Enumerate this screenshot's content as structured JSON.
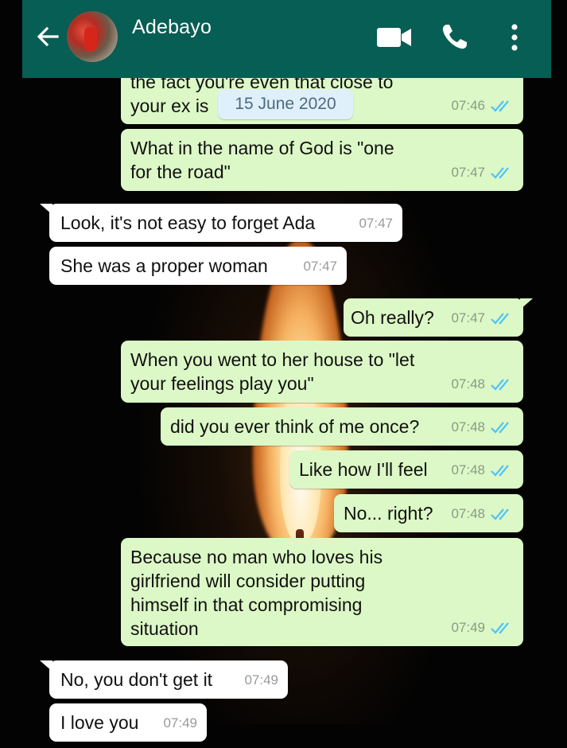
{
  "header": {
    "back_icon": "arrow-left-icon",
    "contact_name": "Adebayo",
    "video_icon": "video-camera-icon",
    "call_icon": "phone-icon",
    "menu_icon": "more-vertical-icon",
    "color": "#075e54"
  },
  "date_chip": "15 June 2020",
  "messages": [
    {
      "dir": "out",
      "lines": [
        "the fact you're even that close to",
        "your ex is"
      ],
      "time": "07:46",
      "ticks": "read"
    },
    {
      "dir": "out",
      "lines": [
        "What in the name of God is \"one",
        "for the road\""
      ],
      "time": "07:47",
      "ticks": "read"
    },
    {
      "dir": "in",
      "lines": [
        "Look, it's not easy to forget Ada"
      ],
      "time": "07:47"
    },
    {
      "dir": "in",
      "lines": [
        "She was a proper woman"
      ],
      "time": "07:47"
    },
    {
      "dir": "out",
      "lines": [
        "Oh really?"
      ],
      "time": "07:47",
      "ticks": "read"
    },
    {
      "dir": "out",
      "lines": [
        "When you went to her house to \"let",
        "your feelings play you\""
      ],
      "time": "07:48",
      "ticks": "read"
    },
    {
      "dir": "out",
      "lines": [
        "did you ever think of me once?"
      ],
      "time": "07:48",
      "ticks": "read"
    },
    {
      "dir": "out",
      "lines": [
        "Like how I'll feel"
      ],
      "time": "07:48",
      "ticks": "read"
    },
    {
      "dir": "out",
      "lines": [
        "No... right?"
      ],
      "time": "07:48",
      "ticks": "read"
    },
    {
      "dir": "out",
      "lines": [
        "Because no man who loves his",
        "girlfriend will consider putting",
        "himself in that compromising",
        "situation"
      ],
      "time": "07:49",
      "ticks": "read"
    },
    {
      "dir": "in",
      "lines": [
        "No, you don't get it"
      ],
      "time": "07:49"
    },
    {
      "dir": "in",
      "lines": [
        "I love you"
      ],
      "time": "07:49"
    }
  ],
  "colors": {
    "outgoing_bubble": "#dcf8c6",
    "incoming_bubble": "#ffffff",
    "read_ticks": "#4fc3f7"
  }
}
